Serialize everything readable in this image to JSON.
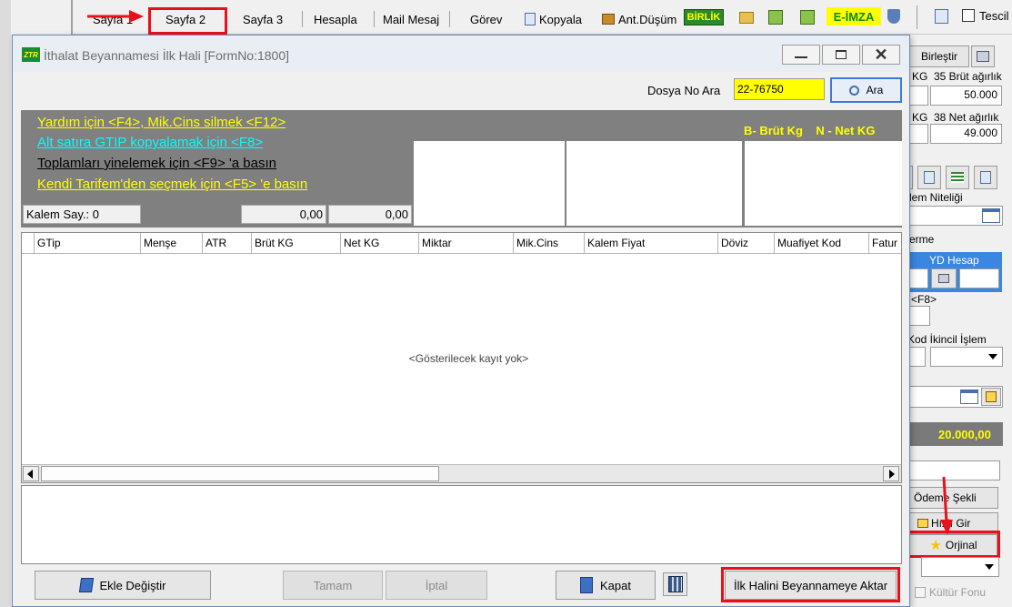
{
  "toolbar": {
    "tabs": [
      "Sayfa 1",
      "Sayfa 2",
      "Sayfa 3",
      "Hesapla",
      "Mail Mesaj",
      "Görev"
    ],
    "kopyala": "Kopyala",
    "ant_dusum": "Ant.Düşüm",
    "birlik": "BİRLİK",
    "eimza": "E-İMZA",
    "tescil": "Tescil"
  },
  "bg": {
    "birlestir": "Birleştir",
    "kg1": "KG",
    "brut_label": "35 Brüt ağırlık",
    "brut_value": "50.000",
    "kg2": "KG",
    "net_label": "38 Net ağırlık",
    "net_value": "49.000",
    "kalem_niteligi": "lem Niteliği",
    "erme": "erme",
    "yd_hesap": "YD Hesap",
    "f8": "<F8>",
    "kod_ikincil": "Kod İkincil İşlem",
    "amount": "20.000,00",
    "odeme_sekli": "Ödeme Şekli",
    "hizli_gir": "Hızlı Gir",
    "orjinal": "Orjinal",
    "kultur_fonu": "Kültür Fonu"
  },
  "dialog": {
    "title": "İthalat Beyannamesi İlk Hali [FormNo:1800]",
    "dosya_label": "Dosya No Ara",
    "dosya_value": "22-76750",
    "ara_button": "Ara",
    "help1": "Yardım için <F4>, Mik.Cins silmek <F12>",
    "help2": "Alt satıra GTIP kopyalamak için <F8>",
    "help3": "Toplamları yinelemek için <F9> 'a basın",
    "help4": "Kendi Tarifem'den seçmek  için <F5> 'e basın",
    "legend": "B- Brüt Kg    N - Net KG",
    "kalem_say": "Kalem Say.: 0",
    "total1": "0,00",
    "total2": "0,00",
    "columns": [
      "GTip",
      "Menşe",
      "ATR",
      "Brüt KG",
      "Net KG",
      "Miktar",
      "Mik.Cins",
      "Kalem Fiyat",
      "Döviz",
      "Muafiyet Kod",
      "Fatur"
    ],
    "empty": "<Gösterilecek kayıt yok>",
    "buttons": {
      "ekle": "Ekle Değiştir",
      "tamam": "Tamam",
      "iptal": "İptal",
      "kapat": "Kapat",
      "aktar": "İlk Halini Beyannameye Aktar"
    }
  },
  "colors": {
    "accent_red": "#e8101a",
    "yellow_text": "#ffff00",
    "cyan_text": "#00ffff",
    "panel_gray": "#808080"
  }
}
